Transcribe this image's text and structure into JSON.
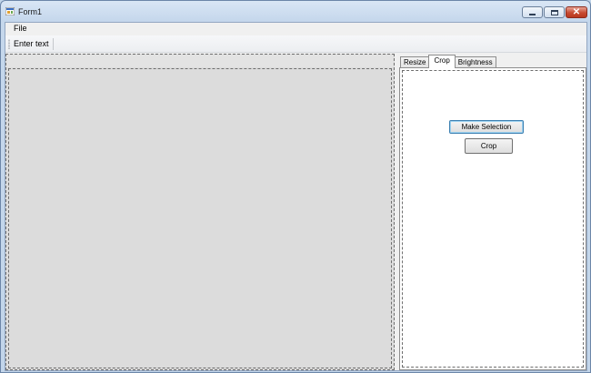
{
  "window": {
    "title": "Form1"
  },
  "menu": {
    "items": [
      {
        "label": "File"
      }
    ]
  },
  "toolbar": {
    "text_item": "Enter text"
  },
  "tabs": [
    {
      "label": "Resize",
      "active": false
    },
    {
      "label": "Crop",
      "active": true
    },
    {
      "label": "Brightness",
      "active": false
    }
  ],
  "crop_tab": {
    "make_selection_label": "Make Selection",
    "crop_label": "Crop"
  },
  "icons": {
    "app": "app-icon",
    "minimize": "minimize-icon",
    "maximize": "maximize-icon",
    "close": "close-icon"
  },
  "colors": {
    "titlebar": "#c2d5ea",
    "close_button": "#c74a31",
    "panel_background": "#dcdcdc",
    "tab_page": "#ffffff"
  }
}
